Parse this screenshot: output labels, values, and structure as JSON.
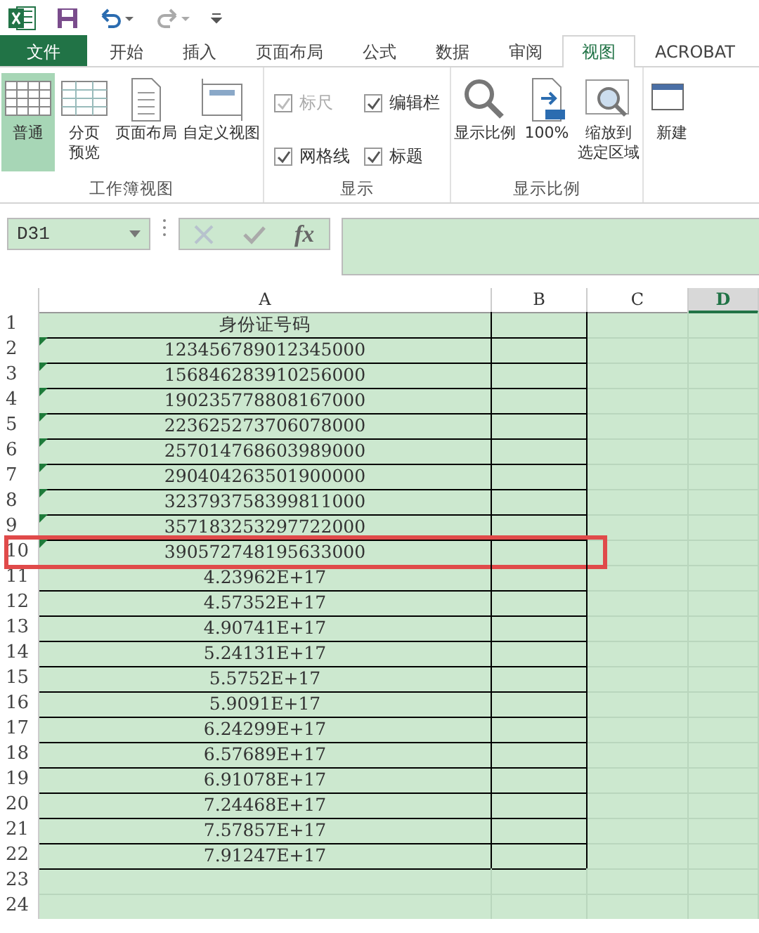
{
  "tabs": [
    {
      "label": "文件",
      "kind": "file",
      "selected": false
    },
    {
      "label": "开始",
      "kind": "tab",
      "selected": false
    },
    {
      "label": "插入",
      "kind": "tab",
      "selected": false
    },
    {
      "label": "页面布局",
      "kind": "tab",
      "selected": false
    },
    {
      "label": "公式",
      "kind": "tab",
      "selected": false
    },
    {
      "label": "数据",
      "kind": "tab",
      "selected": false
    },
    {
      "label": "审阅",
      "kind": "tab",
      "selected": false
    },
    {
      "label": "视图",
      "kind": "tab",
      "selected": true
    },
    {
      "label": "ACROBAT",
      "kind": "tab",
      "selected": false
    }
  ],
  "ribbon": [
    {
      "label": "工作簿视图",
      "kind": "buttons",
      "items": [
        {
          "lines": [
            "普通"
          ],
          "selected": true
        },
        {
          "lines": [
            "分页",
            "预览"
          ],
          "selected": false
        },
        {
          "lines": [
            "页面布局"
          ],
          "selected": false
        },
        {
          "lines": [
            "自定义视图"
          ],
          "selected": false
        }
      ]
    },
    {
      "label": "显示",
      "kind": "checks",
      "items": [
        {
          "label": "标尺",
          "checked": true,
          "disabled": true
        },
        {
          "label": "编辑栏",
          "checked": true,
          "disabled": false
        },
        {
          "label": "网格线",
          "checked": true,
          "disabled": false
        },
        {
          "label": "标题",
          "checked": true,
          "disabled": false
        }
      ]
    },
    {
      "label": "显示比例",
      "kind": "buttons",
      "items": [
        {
          "lines": [
            "显示比例"
          ],
          "selected": false
        },
        {
          "lines": [
            "100%"
          ],
          "selected": false
        },
        {
          "lines": [
            "缩放到",
            "选定区域"
          ],
          "selected": false
        }
      ]
    },
    {
      "kind": "buttons",
      "items": [
        {
          "lines": [
            "新建"
          ],
          "selected": false
        }
      ]
    }
  ],
  "name_box": "D31",
  "formula_bar": {
    "fx": "fx"
  },
  "columns": [
    {
      "label": "A",
      "selected": false
    },
    {
      "label": "B",
      "selected": false
    },
    {
      "label": "C",
      "selected": false
    },
    {
      "label": "D",
      "selected": true
    }
  ],
  "rows": [
    {
      "number": "1",
      "value": "身份证号码",
      "error_mark": false,
      "highlighted": false
    },
    {
      "number": "2",
      "value": "123456789012345000",
      "error_mark": true,
      "highlighted": false
    },
    {
      "number": "3",
      "value": "156846283910256000",
      "error_mark": true,
      "highlighted": false
    },
    {
      "number": "4",
      "value": "190235778808167000",
      "error_mark": true,
      "highlighted": false
    },
    {
      "number": "5",
      "value": "223625273706078000",
      "error_mark": true,
      "highlighted": false
    },
    {
      "number": "6",
      "value": "257014768603989000",
      "error_mark": true,
      "highlighted": false
    },
    {
      "number": "7",
      "value": "290404263501900000",
      "error_mark": true,
      "highlighted": false
    },
    {
      "number": "8",
      "value": "323793758399811000",
      "error_mark": true,
      "highlighted": false
    },
    {
      "number": "9",
      "value": "357183253297722000",
      "error_mark": true,
      "highlighted": false
    },
    {
      "number": "10",
      "value": "390572748195633000",
      "error_mark": true,
      "highlighted": true
    },
    {
      "number": "11",
      "value": "4.23962E+17",
      "error_mark": false,
      "highlighted": false
    },
    {
      "number": "12",
      "value": "4.57352E+17",
      "error_mark": false,
      "highlighted": false
    },
    {
      "number": "13",
      "value": "4.90741E+17",
      "error_mark": false,
      "highlighted": false
    },
    {
      "number": "14",
      "value": "5.24131E+17",
      "error_mark": false,
      "highlighted": false
    },
    {
      "number": "15",
      "value": "5.5752E+17",
      "error_mark": false,
      "highlighted": false
    },
    {
      "number": "16",
      "value": "5.9091E+17",
      "error_mark": false,
      "highlighted": false
    },
    {
      "number": "17",
      "value": "6.24299E+17",
      "error_mark": false,
      "highlighted": false
    },
    {
      "number": "18",
      "value": "6.57689E+17",
      "error_mark": false,
      "highlighted": false
    },
    {
      "number": "19",
      "value": "6.91078E+17",
      "error_mark": false,
      "highlighted": false
    },
    {
      "number": "20",
      "value": "7.24468E+17",
      "error_mark": false,
      "highlighted": false
    },
    {
      "number": "21",
      "value": "7.57857E+17",
      "error_mark": false,
      "highlighted": false
    },
    {
      "number": "22",
      "value": "7.91247E+17",
      "error_mark": false,
      "highlighted": false
    },
    {
      "number": "23",
      "highlighted": false
    },
    {
      "number": "24",
      "highlighted": false
    }
  ]
}
